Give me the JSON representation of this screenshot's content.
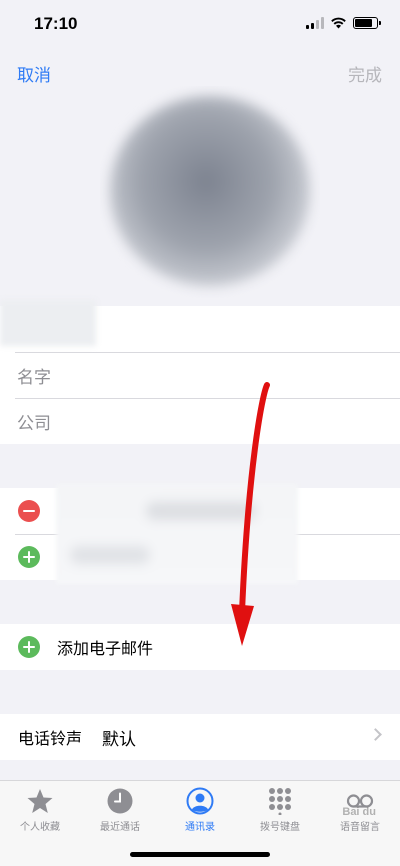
{
  "status_bar": {
    "time": "17:10"
  },
  "nav": {
    "cancel_label": "取消",
    "done_label": "完成"
  },
  "name_section": {
    "first_placeholder": "名字",
    "company_placeholder": "公司"
  },
  "add_email": {
    "label": "添加电子邮件"
  },
  "ringtone": {
    "label": "电话铃声",
    "value": "默认"
  },
  "tabbar": {
    "tabs": [
      {
        "label": "个人收藏",
        "icon": "star-icon"
      },
      {
        "label": "最近通话",
        "icon": "clock-icon"
      },
      {
        "label": "通讯录",
        "icon": "person-circle-icon",
        "active": true
      },
      {
        "label": "拨号键盘",
        "icon": "keypad-icon"
      },
      {
        "label": "语音留言",
        "icon": "voicemail-icon"
      }
    ]
  },
  "colors": {
    "accent": "#2f7bf5",
    "annotation_arrow": "#e01010",
    "delete": "#eb4f4f",
    "add": "#5cba5c"
  }
}
